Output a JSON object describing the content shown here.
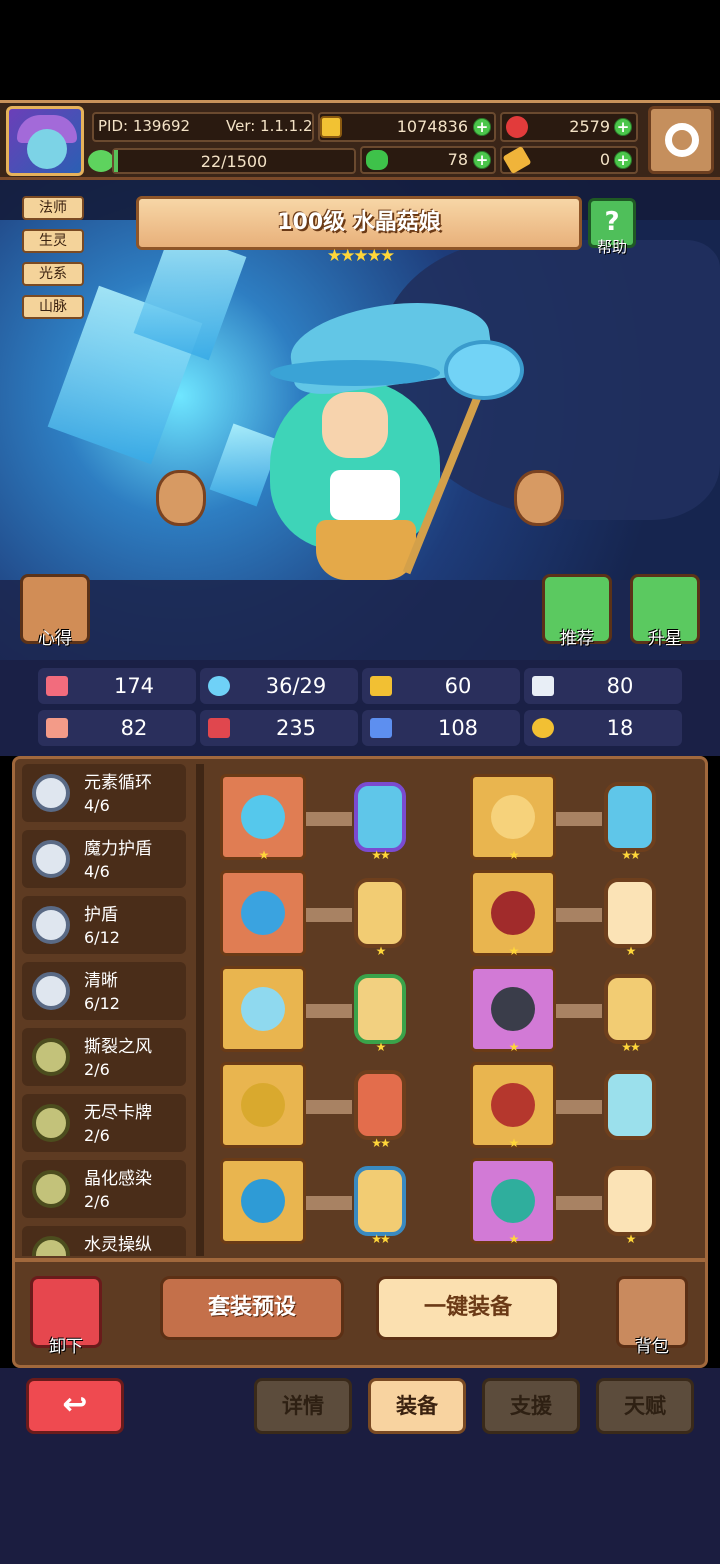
{
  "header": {
    "pid": "PID: 139692",
    "version": "Ver: 1.1.1.2",
    "gold": "1074836",
    "ruby": "2579",
    "exp": "22/1500",
    "clover": "78",
    "key": "0"
  },
  "hero": {
    "title": "100级 水晶菇娘",
    "stars": "★★★★★",
    "tags": [
      "法师",
      "生灵",
      "光系",
      "山脉"
    ],
    "help_label": "帮助",
    "notes_label": "心得",
    "recommend_label": "推荐",
    "starup_label": "升星"
  },
  "stats": {
    "hp": "174",
    "mana": "36/29",
    "defense": "60",
    "speed": "80",
    "attack": "82",
    "magic": "235",
    "resist": "108",
    "luck": "18"
  },
  "sets": [
    {
      "name": "元素循环",
      "count": "4/6"
    },
    {
      "name": "魔力护盾",
      "count": "4/6"
    },
    {
      "name": "护盾",
      "count": "6/12"
    },
    {
      "name": "清晰",
      "count": "6/12"
    },
    {
      "name": "撕裂之风",
      "count": "2/6"
    },
    {
      "name": "无尽卡牌",
      "count": "2/6"
    },
    {
      "name": "晶化感染",
      "count": "2/6"
    },
    {
      "name": "水灵操纵",
      "count": ""
    }
  ],
  "equipment": {
    "left": [
      {
        "item_stars": "★",
        "gem_stars": "★★"
      },
      {
        "item_stars": "",
        "gem_stars": "★"
      },
      {
        "item_stars": "",
        "gem_stars": "★"
      },
      {
        "item_stars": "",
        "gem_stars": "★★"
      },
      {
        "item_stars": "",
        "gem_stars": "★★"
      }
    ],
    "right": [
      {
        "item_stars": "★",
        "gem_stars": "★★"
      },
      {
        "item_stars": "★",
        "gem_stars": "★"
      },
      {
        "item_stars": "★",
        "gem_stars": "★★"
      },
      {
        "item_stars": "★",
        "gem_stars": ""
      },
      {
        "item_stars": "★",
        "gem_stars": "★"
      }
    ]
  },
  "actions": {
    "unload": "卸下",
    "preset": "套装预设",
    "equip_all": "一键装备",
    "bag": "背包"
  },
  "tabs": {
    "details": "详情",
    "equip": "装备",
    "support": "支援",
    "talent": "天赋"
  }
}
